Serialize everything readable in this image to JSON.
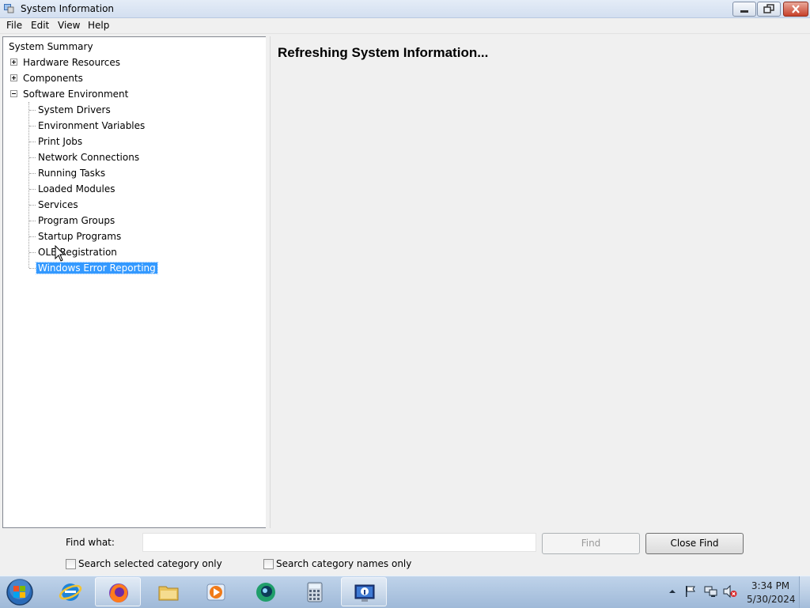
{
  "window": {
    "title": "System Information"
  },
  "menu": [
    "File",
    "Edit",
    "View",
    "Help"
  ],
  "tree": {
    "root": "System Summary",
    "hardware": "Hardware Resources",
    "components": "Components",
    "software": "Software Environment",
    "software_children": [
      "System Drivers",
      "Environment Variables",
      "Print Jobs",
      "Network Connections",
      "Running Tasks",
      "Loaded Modules",
      "Services",
      "Program Groups",
      "Startup Programs",
      "OLE Registration",
      "Windows Error Reporting"
    ],
    "selected": "Windows Error Reporting"
  },
  "content": {
    "message": "Refreshing System Information..."
  },
  "find": {
    "label": "Find what:",
    "value": "",
    "find_button": "Find",
    "close_button": "Close Find",
    "opt_selected_category": "Search selected category only",
    "opt_category_names": "Search category names only"
  },
  "taskbar": {
    "items": [
      "internet-explorer",
      "firefox",
      "file-explorer",
      "media-player",
      "chat-app",
      "calculator",
      "system-information"
    ],
    "active": "system-information"
  },
  "clock": {
    "time": "3:34 PM",
    "date": "5/30/2024"
  },
  "colors": {
    "selection": "#3399ff",
    "taskbar": "#a9c2de"
  }
}
